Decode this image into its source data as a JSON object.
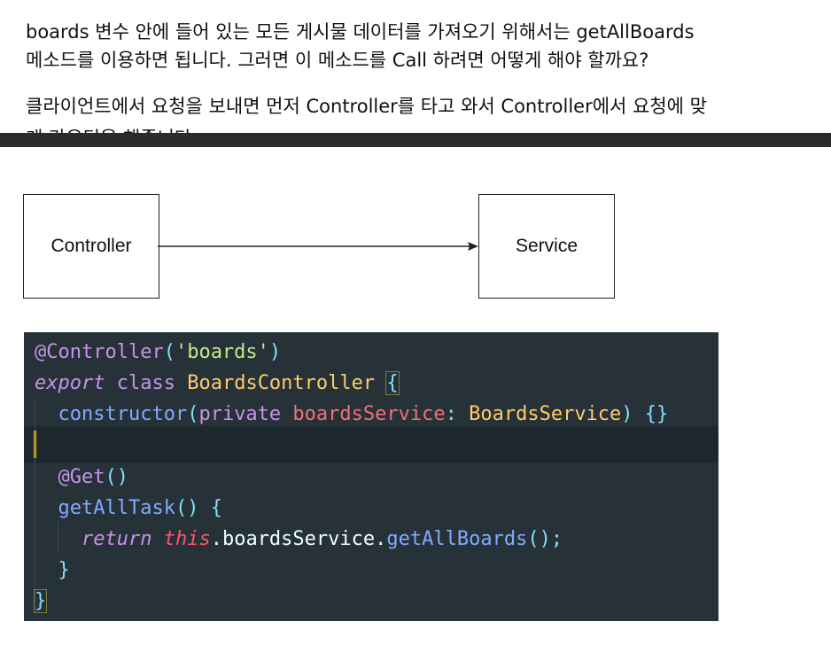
{
  "paragraph1": {
    "line1": "boards 변수 안에 들어 있는 모든 게시물 데이터를 가져오기 위해서는 getAllBoards",
    "line2": "메소드를 이용하면 됩니다.  그러면 이 메소드를 Call 하려면 어떻게 해야 할까요?"
  },
  "paragraph2": {
    "line1": "클라이언트에서 요청을 보내면 먼저 Controller를 타고 와서 Controller에서 요청에 맞",
    "line2": "게 라우팅을 해줍니다."
  },
  "diagram": {
    "left_box": "Controller",
    "right_box": "Service"
  },
  "code": {
    "l1": {
      "dec": "@Controller",
      "p1": "(",
      "str": "'boards'",
      "p2": ")"
    },
    "l2": {
      "kw1": "export",
      "kw2": "class",
      "cls": "BoardsController",
      "brace": "{"
    },
    "l3": {
      "fn": "constructor",
      "p1": "(",
      "kw": "private",
      "prop": "boardsService",
      "colon": ":",
      "type": "BoardsService",
      "p2": ")",
      "braces": "{}"
    },
    "l5": {
      "dec": "@Get",
      "p": "()"
    },
    "l6": {
      "fn": "getAllTask",
      "p": "()",
      "brace": "{"
    },
    "l7": {
      "kw": "return",
      "this": "this",
      "dot1": ".",
      "prop": "boardsService",
      "dot2": ".",
      "fn": "getAllBoards",
      "end": "();"
    },
    "l8": {
      "brace": "}"
    },
    "l9": {
      "brace": "}"
    }
  }
}
